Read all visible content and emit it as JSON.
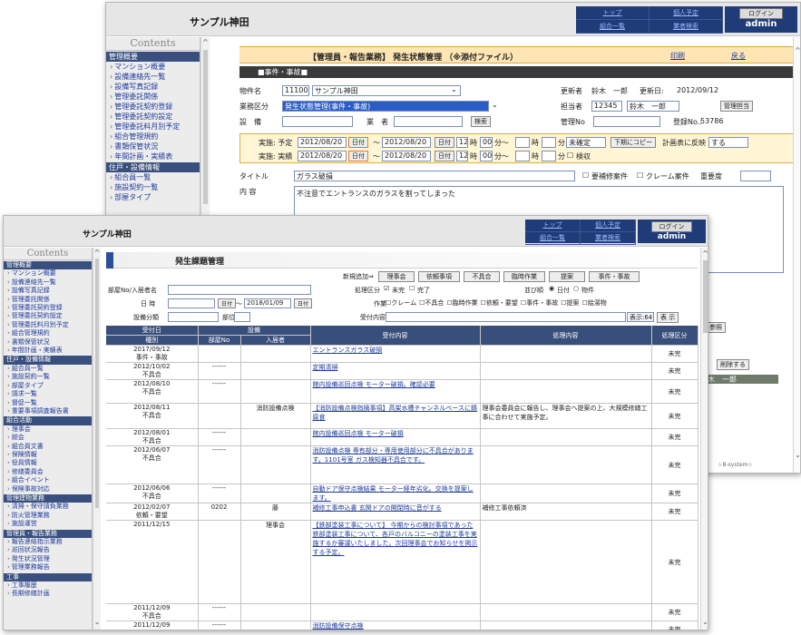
{
  "back": {
    "site_name": "サンプル神田",
    "nav": [
      "トップ",
      "個人予定",
      "組合一覧",
      "業者検索"
    ],
    "login_label": "ログイン",
    "user": "admin",
    "sidebar_title": "Contents",
    "sidebar": [
      {
        "type": "section",
        "label": "管理概要"
      },
      {
        "type": "item",
        "label": "マンション概要"
      },
      {
        "type": "item",
        "label": "設備連絡先一覧"
      },
      {
        "type": "item",
        "label": "設備写真記録"
      },
      {
        "type": "item",
        "label": "管理委託関係"
      },
      {
        "type": "item",
        "label": "管理委託契約登録"
      },
      {
        "type": "item",
        "label": "管理委託契約設定"
      },
      {
        "type": "item",
        "label": "管理委託料月別予定"
      },
      {
        "type": "item",
        "label": "組合管理規約"
      },
      {
        "type": "item",
        "label": "書類保管状況"
      },
      {
        "type": "item",
        "label": "年間計画・実績表"
      },
      {
        "type": "section",
        "label": "住戸・設備情報"
      },
      {
        "type": "item",
        "label": "組合員一覧"
      },
      {
        "type": "item",
        "label": "施設契約一覧"
      },
      {
        "type": "item",
        "label": "部屋タイプ"
      }
    ],
    "page_title": "【管理員・報告業務】 発生状態管理 （※添付ファイル）",
    "print": "印刷",
    "back_link": "戻る",
    "tab": "■事件・事故■",
    "property_label": "物件名",
    "property_code": "11100",
    "property_name": "サンプル神田",
    "updater_label": "更新者",
    "updater": "鈴木　一郎",
    "update_date_label": "更新日:",
    "update_date": "2012/09/12",
    "category_label": "業務区分",
    "category_value": "発生状態管理(事件・事故)",
    "assignee_label": "担当者",
    "assignee_code": "12345",
    "assignee_name": "鈴木　一郎",
    "assignee_btn": "管理担当",
    "equipment_label": "設　備",
    "vendor_label": "業　者",
    "search_btn": "検索",
    "manage_no_label": "管理No",
    "reg_no_label": "登録No.:",
    "reg_no": "53786",
    "plan_label": "実施: 予定",
    "actual_label": "実施: 実績",
    "date_a": "2012/08/20",
    "date_b": "2012/08/20",
    "date_btn": "日付",
    "hour": "12",
    "minute": "00",
    "hour_unit": "時",
    "minute_unit": "分〜",
    "minute_unit2": "分",
    "status_sel": "未確定",
    "copy_btn": "下期にコピー",
    "plan_reflect_label": "計画表に反映",
    "plan_reflect_val": "する",
    "inspection_label": "検収",
    "title_label": "タイトル",
    "title_value": "ガラス破損",
    "needs_repair_label": "要補修案件",
    "complaint_label": "クレーム案件",
    "importance_label": "重要度",
    "content_label": "内 容",
    "content_value": "不注意でエントランスのガラスを割ってしまった",
    "ref_btn": "参照",
    "delete_btn": "削除する",
    "status_person": "鈴木　一郎",
    "footer": "☆B-system☆"
  },
  "front": {
    "site_name": "サンプル神田",
    "nav": [
      "トップ",
      "個人予定",
      "組合一覧",
      "業者検索"
    ],
    "login_label": "ログイン",
    "user": "admin",
    "sidebar_title": "Contents",
    "sidebar": [
      {
        "type": "section",
        "label": "管理概要"
      },
      {
        "type": "item",
        "label": "マンション概要"
      },
      {
        "type": "item",
        "label": "設備連絡先一覧"
      },
      {
        "type": "item",
        "label": "設備写真記録"
      },
      {
        "type": "item",
        "label": "管理委託関係"
      },
      {
        "type": "item",
        "label": "管理委託契約登録"
      },
      {
        "type": "item",
        "label": "管理委託契約設定"
      },
      {
        "type": "item",
        "label": "管理委託料月別予定"
      },
      {
        "type": "item",
        "label": "組合管理規約"
      },
      {
        "type": "item",
        "label": "書類保管状況"
      },
      {
        "type": "item",
        "label": "年間計画・実績表"
      },
      {
        "type": "section",
        "label": "住戸・設備情報"
      },
      {
        "type": "item",
        "label": "組合員一覧"
      },
      {
        "type": "item",
        "label": "施設契約一覧"
      },
      {
        "type": "item",
        "label": "部屋タイプ"
      },
      {
        "type": "item",
        "label": "請求一覧"
      },
      {
        "type": "item",
        "label": "督促一覧"
      },
      {
        "type": "item",
        "label": "重要事項調査報告書"
      },
      {
        "type": "section",
        "label": "組合活動"
      },
      {
        "type": "item",
        "label": "理事会"
      },
      {
        "type": "item",
        "label": "総会"
      },
      {
        "type": "item",
        "label": "組合員文書"
      },
      {
        "type": "item",
        "label": "保険情報"
      },
      {
        "type": "item",
        "label": "役員情報"
      },
      {
        "type": "item",
        "label": "修繕委員会"
      },
      {
        "type": "item",
        "label": "組合イベント"
      },
      {
        "type": "item",
        "label": "保険事故対応"
      },
      {
        "type": "section",
        "label": "管理建物業務"
      },
      {
        "type": "item",
        "label": "清掃・保守請負業務"
      },
      {
        "type": "item",
        "label": "防火管理業務"
      },
      {
        "type": "item",
        "label": "施設運営"
      },
      {
        "type": "section",
        "label": "管理員・報告業務"
      },
      {
        "type": "item",
        "label": "報告連絡指示業務"
      },
      {
        "type": "item",
        "label": "巡回状況報告"
      },
      {
        "type": "item",
        "label": "発生状況管理"
      },
      {
        "type": "item",
        "label": "管理業務報告"
      },
      {
        "type": "section",
        "label": "工事"
      },
      {
        "type": "item",
        "label": "工事履歴"
      },
      {
        "type": "item",
        "label": "長期修繕計画"
      }
    ],
    "page_title": "発生課題管理",
    "new_add_label": "新規追加⇒",
    "actions": [
      "理事会",
      "依頼事項",
      "不具合",
      "臨時作業",
      "提案",
      "事件・事故"
    ],
    "room_label": "部屋No/入居者名",
    "process_label": "処理区分",
    "unfinished": "未完",
    "finished": "完了",
    "sort_label": "並び順",
    "sort_date": "日付",
    "sort_item": "物件",
    "date_label": "日 時",
    "date_btn": "日付",
    "date_range_sep": "〜",
    "date_to": "2018/01/09",
    "work_label": "作業",
    "work_types": [
      "クレーム",
      "不具合",
      "臨時作業",
      "依頼・要望",
      "事件・事故",
      "提案",
      "給湯物"
    ],
    "equip_class_label": "設備分類",
    "dept_label": "部位",
    "accept_label": "受付内容",
    "display_count": "表示:64",
    "display_btn": "表 示",
    "col_accept_date": "受付日",
    "col_type": "種別",
    "col_equipment": "設備",
    "col_room": "部屋No",
    "col_resident": "入居者",
    "col_content": "受付内容",
    "col_process": "処理内容",
    "col_status": "処理区分",
    "rows": [
      {
        "date": "2017/09/12",
        "type": "事件・事故",
        "room": "",
        "resident": "",
        "content": "エントランスガラス破損",
        "process": "",
        "status": "未完"
      },
      {
        "date": "2012/10/02",
        "type": "不具合",
        "room": "------",
        "resident": "",
        "content": "定期清掃",
        "process": "",
        "status": "未完"
      },
      {
        "date": "2012/08/10",
        "type": "不具合",
        "room": "------",
        "resident": "",
        "content": "館内設備巡回点検 モーター破損。確認必要",
        "process": "",
        "status": "未完"
      },
      {
        "date": "2012/08/11",
        "type": "不具合",
        "room": "",
        "resident": "消防設備点検",
        "content": "【消防設備点検指摘事項】高架水槽チャンネルベースに錆 腐食",
        "process": "理事会委員会に報告し、理事会へ提案の上、大規模修繕工事に合わせて実施予定。",
        "status": "未完"
      },
      {
        "date": "2012/08/01",
        "type": "不具合",
        "room": "------",
        "resident": "",
        "content": "館内設備巡回点検 モーター破損",
        "process": "",
        "status": "未完"
      },
      {
        "date": "2012/06/07",
        "type": "不具合",
        "room": "------",
        "resident": "",
        "content": "消防設備点検 専有部分・専用使用部分に不具合があります。1101号室 ガス検知器不具合です。",
        "process": "",
        "status": "未完"
      },
      {
        "date": "2012/06/06",
        "type": "不具合",
        "room": "------",
        "resident": "",
        "content": "自動ドア保守点検結果 モーター経年劣化。交換を提案します。",
        "process": "",
        "status": "未完"
      },
      {
        "date": "2012/02/07",
        "type": "依頼・要望",
        "room": "0202",
        "resident": "藤",
        "content": "補修工事申込書 玄関ドアの開閉時に音がする",
        "process": "補修工事依頼済",
        "status": "未完"
      },
      {
        "date": "2011/12/15",
        "type": "",
        "room": "",
        "resident": "理事会",
        "content": "【鉄部塗装工事について】 今期からの検討事項であった鉄部塗装工事について、各戸のバルコニーの塗装工事を実施するか審議いたしました。次回理事会でお知らせを掲示する予定。",
        "process": "",
        "status": "未完"
      },
      {
        "date": "2011/12/09",
        "type": "不具合",
        "room": "------",
        "resident": "",
        "content": "",
        "process": "",
        "status": "未完"
      },
      {
        "date": "2011/12/09",
        "type": "不具合",
        "room": "------",
        "resident": "",
        "content": "消防設備保守点検",
        "process": "",
        "status": "未完"
      }
    ]
  }
}
